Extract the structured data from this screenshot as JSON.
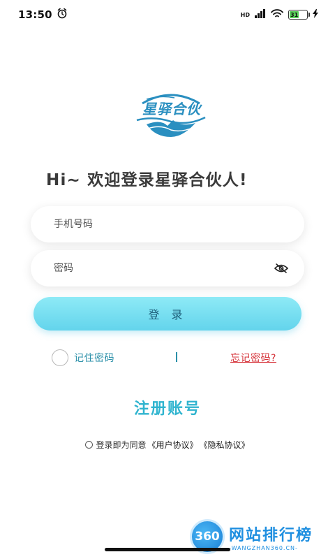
{
  "status_bar": {
    "time": "13:50",
    "battery": "31",
    "network": "HD"
  },
  "logo": {
    "text": "星驿合伙"
  },
  "welcome": "Hi~ 欢迎登录星驿合伙人!",
  "form": {
    "phone_placeholder": "手机号码",
    "password_placeholder": "密码",
    "login_label": "登 录",
    "remember_label": "记住密码",
    "forgot_label": "忘记密码?"
  },
  "register_label": "注册账号",
  "agreement": {
    "prefix": "登录即为同意",
    "user_agreement": "《用户协议》",
    "privacy_agreement": "《隐私协议》"
  },
  "watermark": {
    "badge": "360",
    "title": "网站排行榜",
    "subtitle": "-WANGZHAN360.CN-"
  },
  "colors": {
    "accent": "#2fb4cf",
    "button": "#7ae0f2",
    "forgot": "#d6333a"
  }
}
